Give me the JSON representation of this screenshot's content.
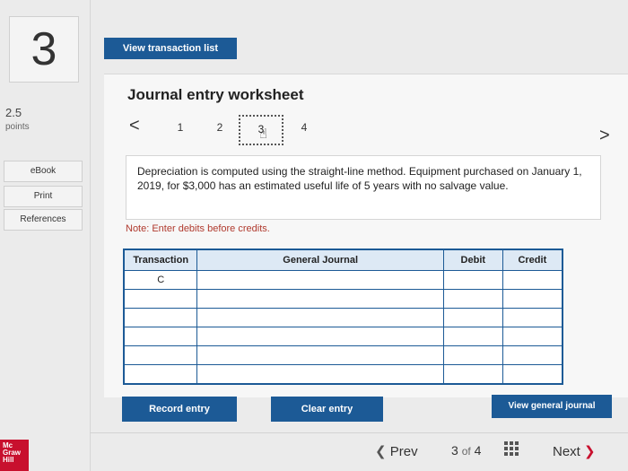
{
  "question": {
    "number": "3",
    "points_value": "2.5",
    "points_label": "points"
  },
  "sidebar": {
    "links": [
      "eBook",
      "Print",
      "References"
    ]
  },
  "logo": {
    "lines": [
      "Mc",
      "Graw",
      "Hill"
    ]
  },
  "header": {
    "view_transaction_list": "View transaction list"
  },
  "worksheet": {
    "title": "Journal entry worksheet",
    "prev_arrow": "<",
    "next_arrow": ">",
    "steps": [
      "1",
      "2",
      "3",
      "4"
    ],
    "active_step": "3",
    "description": "Depreciation is computed using the straight-line method. Equipment purchased on January 1, 2019, for $3,000 has an estimated useful life of 5 years with no salvage value.",
    "note": "Note: Enter debits before credits."
  },
  "table": {
    "headers": [
      "Transaction",
      "General Journal",
      "Debit",
      "Credit"
    ],
    "rows": [
      [
        "C",
        "",
        "",
        ""
      ],
      [
        "",
        "",
        "",
        ""
      ],
      [
        "",
        "",
        "",
        ""
      ],
      [
        "",
        "",
        "",
        ""
      ],
      [
        "",
        "",
        "",
        ""
      ],
      [
        "",
        "",
        "",
        ""
      ]
    ]
  },
  "buttons": {
    "record_entry": "Record entry",
    "clear_entry": "Clear entry",
    "view_general_journal": "View general journal"
  },
  "footer": {
    "prev_label": "Prev",
    "page_current": "3",
    "page_of": "of",
    "page_total": "4",
    "next_label": "Next"
  },
  "colors": {
    "primary_blue": "#1c5a96",
    "brand_red": "#c8102e",
    "note_red": "#b03a2e"
  }
}
